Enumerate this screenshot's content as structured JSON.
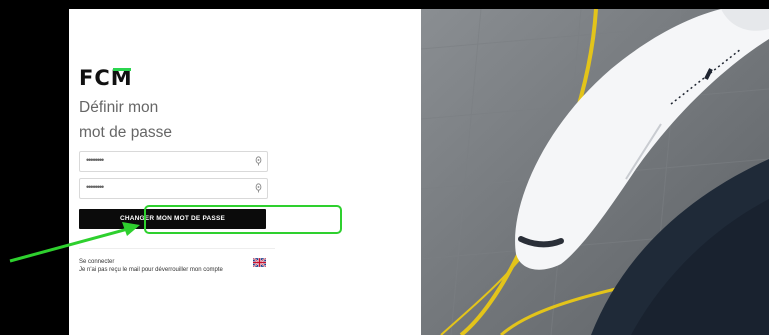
{
  "brand": {
    "logo_prefix": "FC",
    "logo_last": "M",
    "accent_color": "#2bd64f"
  },
  "page": {
    "title_line1": "Définir mon",
    "title_line2": "mot de passe"
  },
  "form": {
    "password_value": "••••••••",
    "confirm_value": "••••••••",
    "submit_label": "CHANGER MON MOT DE PASSE"
  },
  "links": {
    "login": "Se connecter",
    "resend": "Je n'ai pas reçu le mail pour déverrouiller mon compte"
  },
  "language": {
    "icon": "uk-flag-icon"
  },
  "annotation": {
    "arrow_color": "#2ed02e"
  }
}
